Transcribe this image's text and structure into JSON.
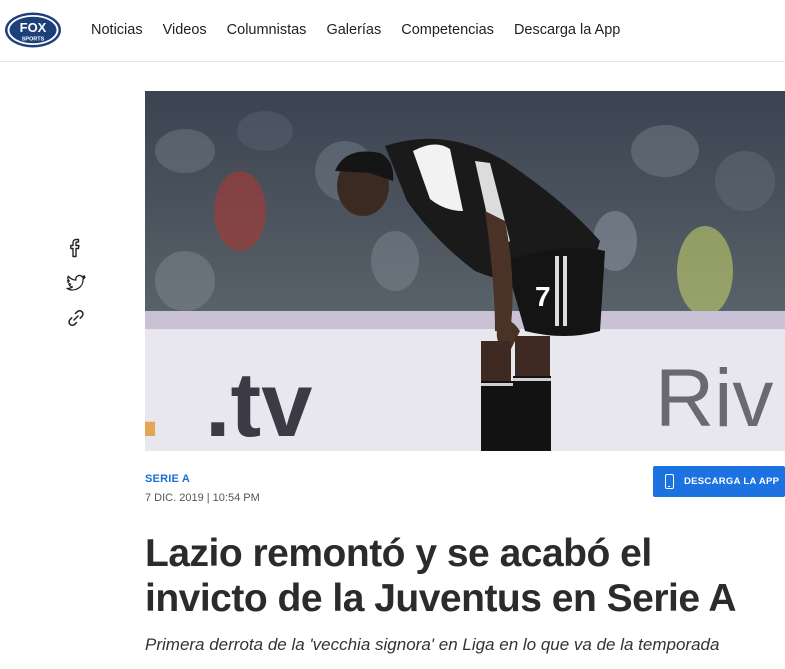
{
  "header": {
    "logo_text_top": "FOX",
    "logo_text_bottom": "SPORTS",
    "nav": [
      "Noticias",
      "Videos",
      "Columnistas",
      "Galerías",
      "Competencias",
      "Descarga la App"
    ]
  },
  "hero": {
    "image": "football-player-bent-over-photo",
    "board_text_left": ".tv",
    "board_text_right": "Riv",
    "jersey_number": "7"
  },
  "social": [
    "facebook-icon",
    "twitter-icon",
    "link-icon"
  ],
  "article": {
    "category": "SERIE A",
    "date": "7 DIC. 2019 | 10:54 PM",
    "app_button": "DESCARGA LA APP",
    "title_line1": "Lazio remontó y se acabó el",
    "title_line2": "invicto de la Juventus en Serie A",
    "subtitle": "Primera derrota de la 'vecchia signora' en Liga en lo que va de la temporada"
  },
  "colors": {
    "accent": "#1c72e0",
    "category": "#1b6fd8",
    "title": "#2b2b2b"
  }
}
